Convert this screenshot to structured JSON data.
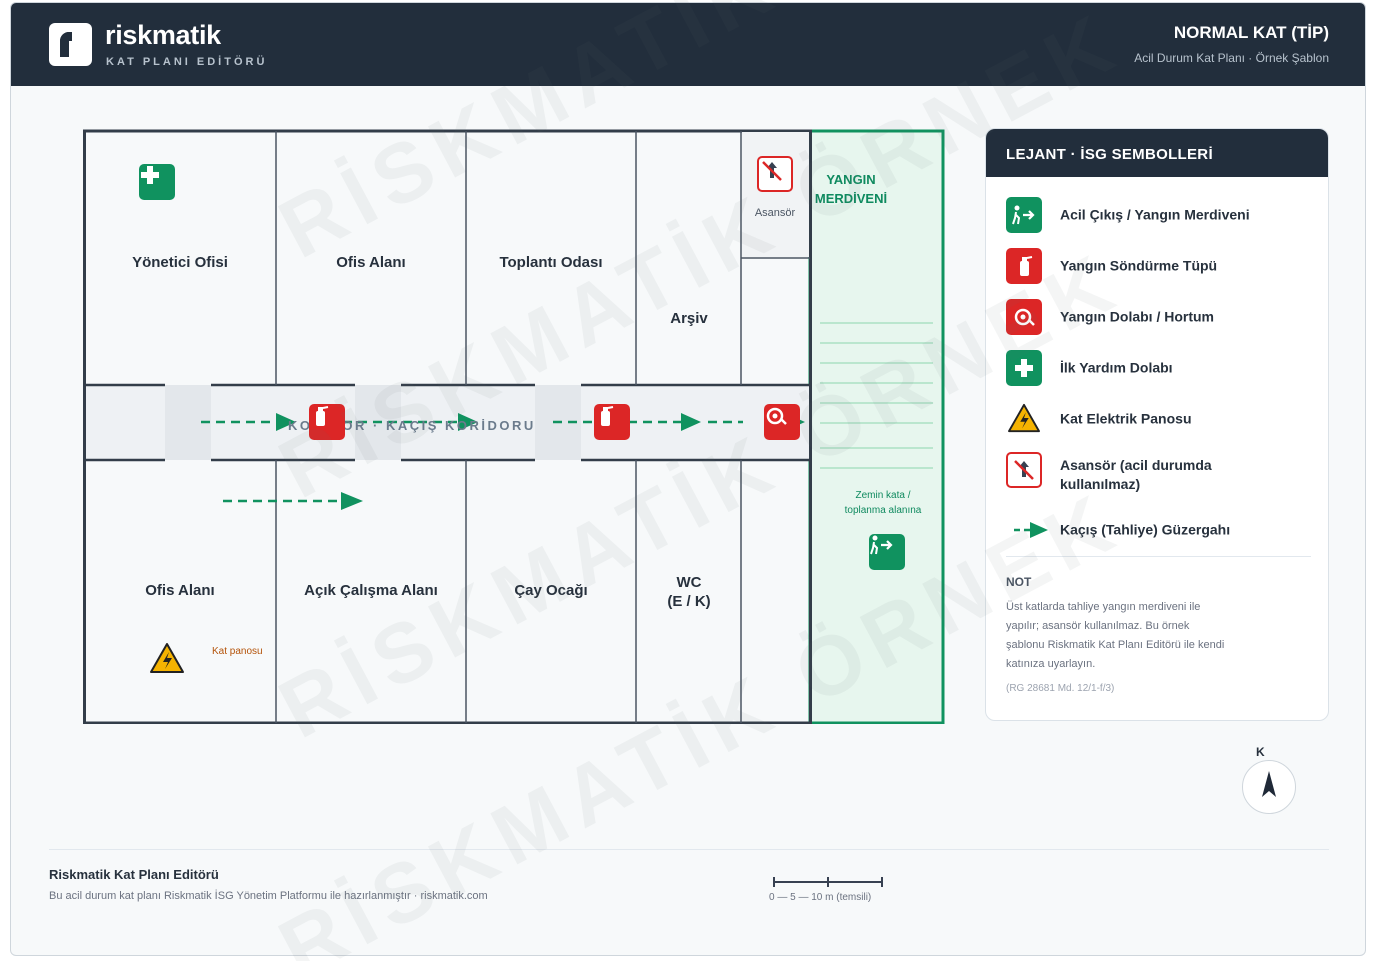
{
  "header": {
    "brand": "riskmatik",
    "brand_sub": "KAT PLANI EDİTÖRÜ",
    "title": "NORMAL KAT (TİP)",
    "subtitle": "Acil Durum Kat Planı · Örnek Şablon"
  },
  "plan": {
    "rooms": {
      "manager_office": "Yönetici Ofisi",
      "office_top": "Ofis Alanı",
      "meeting_room": "Toplantı Odası",
      "archive": "Arşiv",
      "elevator": "Asansör",
      "stair_title_line1": "YANGIN",
      "stair_title_line2": "MERDİVENİ",
      "office_bottom": "Ofis Alanı",
      "open_work": "Açık Çalışma Alanı",
      "tea_room": "Çay Ocağı",
      "wc_line1": "WC",
      "wc_line2": "(E / K)"
    },
    "corridor_label": "KORİDOR · KAÇIŞ KORİDORU",
    "panel_note": "Kat panosu",
    "stair_note_line1": "Zemin kata /",
    "stair_note_line2": "toplanma alanına"
  },
  "legend": {
    "title": "LEJANT · İSG SEMBOLLERİ",
    "items": [
      {
        "label": "Acil Çıkış / Yangın Merdiveni",
        "icon": "emergency-exit-icon"
      },
      {
        "label": "Yangın Söndürme Tüpü",
        "icon": "fire-extinguisher-icon"
      },
      {
        "label": "Yangın Dolabı / Hortum",
        "icon": "fire-hose-icon"
      },
      {
        "label": "İlk Yardım Dolabı",
        "icon": "first-aid-icon"
      },
      {
        "label": "Kat Elektrik Panosu",
        "icon": "electric-hazard-icon"
      },
      {
        "label": "Asansör (acil durumda kullanılmaz)",
        "icon": "no-elevator-icon"
      },
      {
        "label": "Kaçış (Tahliye) Güzergahı",
        "icon": "escape-route-arrow-icon"
      }
    ],
    "note_title": "NOT",
    "note_text": "Üst katlarda tahliye yangın merdiveni ile yapılır; asansör kullanılmaz. Bu örnek şablonu Riskmatik Kat Planı Editörü ile kendi katınıza uyarlayın.",
    "note_ref": "(RG 28681 Md. 12/1-f/3)"
  },
  "compass": {
    "label": "K"
  },
  "footer": {
    "title": "Riskmatik Kat Planı Editörü",
    "subtitle": "Bu acil durum kat planı Riskmatik İSG Yönetim Platformu ile hazırlanmıştır · riskmatik.com",
    "scale_text": "0 — 5 — 10 m (temsili)"
  },
  "watermark": {
    "text": "RİSKMATİK ÖRNEK"
  },
  "colors": {
    "header_bg": "#222e3c",
    "exit_green": "#10925f",
    "fire_red": "#dc2626",
    "hazard_yellow": "#f5b301",
    "stair_fill": "#e7f6ee"
  }
}
